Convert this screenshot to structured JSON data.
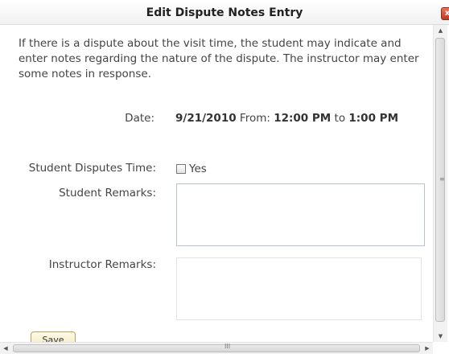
{
  "dialog": {
    "title": "Edit Dispute Notes Entry",
    "close_glyph": "x",
    "intro": "If there is a dispute about the visit time, the student may indicate and enter notes regarding the nature of the dispute. The instructor may enter some notes in response."
  },
  "visit": {
    "date_label": "Date:",
    "date": "9/21/2010",
    "from_label": "From:",
    "from_time": "12:00 PM",
    "to_label": "to",
    "to_time": "1:00 PM"
  },
  "form": {
    "disputes_label": "Student Disputes Time:",
    "disputes_option": "Yes",
    "disputes_checked": false,
    "student_remarks_label": "Student Remarks:",
    "student_remarks_value": "",
    "instructor_remarks_label": "Instructor Remarks:",
    "instructor_remarks_value": "",
    "save_label": "Save"
  },
  "scrollbars": {
    "up_arrow": "▲",
    "down_arrow": "▼",
    "left_arrow": "◀",
    "right_arrow": "▶",
    "grip": "≡",
    "h_grip": "III"
  }
}
